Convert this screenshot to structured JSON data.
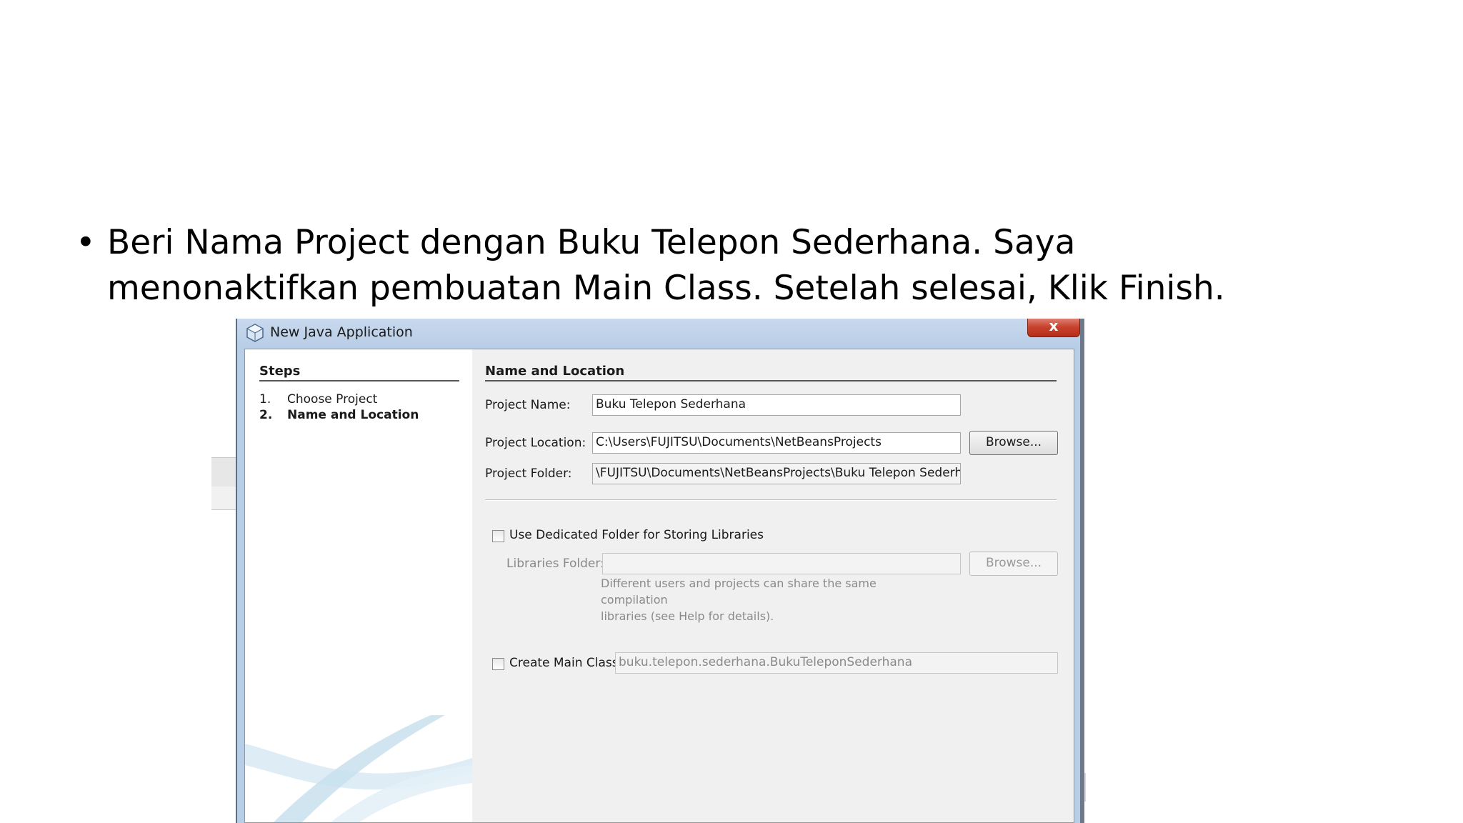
{
  "slide": {
    "bullet_line_1": "Beri Nama Project dengan Buku Telepon Sederhana. Saya",
    "bullet_line_2": "menonaktifkan pembuatan Main Class. Setelah selesai, Klik Finish."
  },
  "window": {
    "title": "New Java Application",
    "close_glyph": "x",
    "icon": "java-cup-icon"
  },
  "steps": {
    "heading": "Steps",
    "items": [
      {
        "num": "1.",
        "label": "Choose Project",
        "current": false
      },
      {
        "num": "2.",
        "label": "Name and Location",
        "current": true
      }
    ]
  },
  "form": {
    "heading": "Name and Location",
    "project_name_label": "Project Name:",
    "project_name_value": "Buku Telepon Sederhana",
    "project_location_label": "Project Location:",
    "project_location_value": "C:\\Users\\FUJITSU\\Documents\\NetBeansProjects",
    "browse_label": "Browse...",
    "project_folder_label": "Project Folder:",
    "project_folder_value": "\\FUJITSU\\Documents\\NetBeansProjects\\Buku Telepon Sederhana",
    "dedicated_folder_label": "Use Dedicated Folder for Storing Libraries",
    "dedicated_folder_checked": false,
    "libraries_folder_label": "Libraries Folder:",
    "libraries_folder_value": "",
    "libraries_browse_label": "Browse...",
    "note_line_1": "Different users and projects can share the same compilation",
    "note_line_2": "libraries (see Help for details).",
    "create_main_label": "Create Main Class",
    "create_main_checked": false,
    "main_class_value": "buku.telepon.sederhana.BukuTeleponSederhana"
  }
}
